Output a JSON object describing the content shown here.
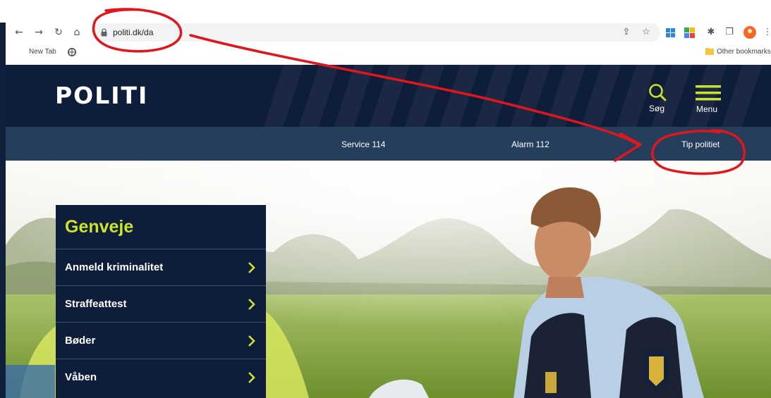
{
  "browser": {
    "url": "politi.dk/da",
    "bookmarks": {
      "new_tab_label": "New Tab",
      "other_bookmarks_label": "Other bookmarks"
    },
    "nav_icons": [
      "back-icon",
      "forward-icon",
      "reload-icon",
      "home-icon"
    ]
  },
  "site": {
    "logo_text": "POLITI",
    "search_label": "Søg",
    "menu_label": "Menu",
    "accent_color": "#cde22a",
    "header_color": "#0e1d3a",
    "service_bar_color": "#243e5c"
  },
  "service_bar": {
    "links": [
      "Service 114",
      "Alarm 112",
      "Tip politiet"
    ]
  },
  "shortcuts": {
    "title": "Genveje",
    "items": [
      "Anmeld kriminalitet",
      "Straffeattest",
      "Bøder",
      "Våben"
    ]
  },
  "annotation": {
    "color": "#e0161c"
  }
}
